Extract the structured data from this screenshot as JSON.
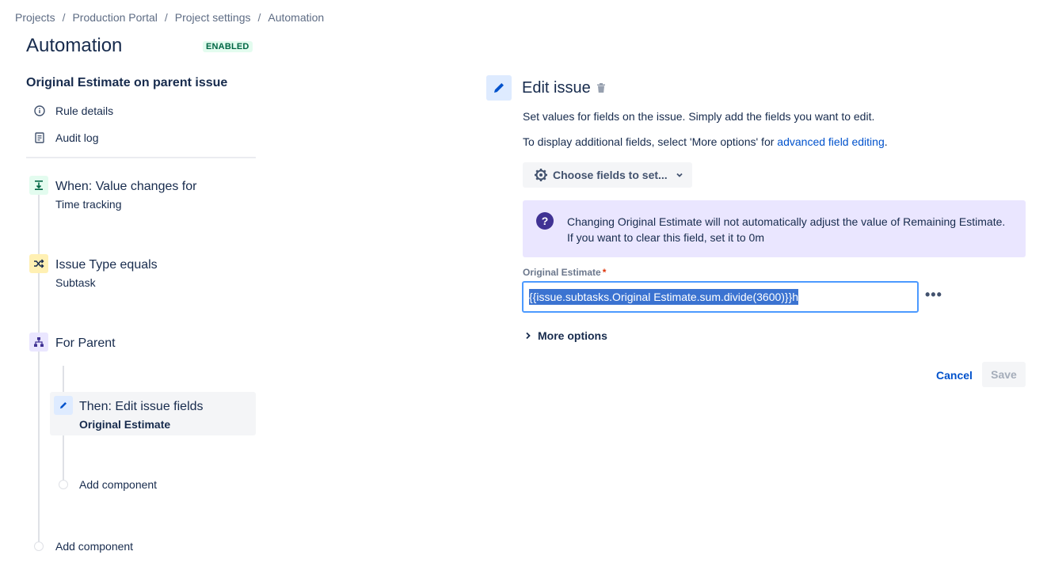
{
  "breadcrumb": [
    "Projects",
    "Production Portal",
    "Project settings",
    "Automation"
  ],
  "breadcrumb_separator": "/",
  "page_title": "Automation",
  "status_lozenge": "ENABLED",
  "rule_name": "Original Estimate on parent issue",
  "nav": {
    "rule_details": "Rule details",
    "audit_log": "Audit log"
  },
  "components": {
    "trigger": {
      "title": "When: Value changes for",
      "subtitle": "Time tracking"
    },
    "condition": {
      "title": "Issue Type equals",
      "subtitle": "Subtask"
    },
    "branch": {
      "title": "For Parent"
    },
    "action": {
      "title": "Then: Edit issue fields",
      "subtitle": "Original Estimate"
    },
    "add_component_inner": "Add component",
    "add_component_outer": "Add component"
  },
  "editor": {
    "title": "Edit issue",
    "desc1": "Set values for fields on the issue. Simply add the fields you want to edit.",
    "desc2_prefix": "To display additional fields, select 'More options' for ",
    "desc2_link": "advanced field editing",
    "desc2_suffix": ".",
    "choose_fields": "Choose fields to set...",
    "info_line1": "Changing Original Estimate will not automatically adjust the value of Remaining Estimate.",
    "info_line2": "If you want to clear this field, set it to 0m",
    "field_label": "Original Estimate",
    "field_required_mark": "*",
    "field_value": "{{issue.subtasks.Original Estimate.sum.divide(3600)}}h",
    "ellipsis": "•••",
    "more_options": "More options",
    "cancel": "Cancel",
    "save": "Save"
  },
  "colors": {
    "primary": "#0052cc",
    "trigger_bg": "#e3fcef",
    "condition_bg": "#fff0b3",
    "branch_bg": "#eae6ff",
    "action_bg": "#deebff",
    "info_bg": "#eae6ff"
  }
}
